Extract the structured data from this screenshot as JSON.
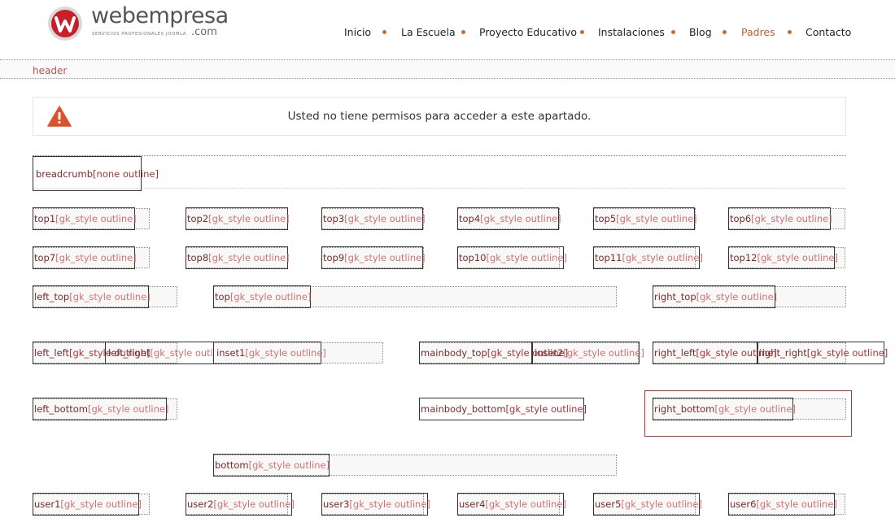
{
  "brand": {
    "name": "webempresa",
    "tagline": "servicios profesionales joomla",
    "suffix": ".com",
    "colors": {
      "red": "#c8202a",
      "accent": "#d0692f",
      "text_red": "#c0504d"
    }
  },
  "nav": {
    "items": [
      {
        "label": "Inicio",
        "active": false
      },
      {
        "label": "La Escuela",
        "active": false
      },
      {
        "label": "Proyecto Educativo",
        "active": false
      },
      {
        "label": "Instalaciones",
        "active": false
      },
      {
        "label": "Blog",
        "active": false
      },
      {
        "label": "Padres",
        "active": true
      },
      {
        "label": "Contacto",
        "active": false
      }
    ]
  },
  "header_label": "header",
  "alert": {
    "icon": "warning-triangle-icon",
    "message": "Usted no tiene permisos para acceder a este apartado."
  },
  "breadcrumb": {
    "position": "breadcrumb",
    "style": "[none outline]"
  },
  "style_label": "[gk_style outline]",
  "rows": {
    "top_a": [
      "top1",
      "top2",
      "top3",
      "top4",
      "top5",
      "top6"
    ],
    "top_b": [
      "top7",
      "top8",
      "top9",
      "top10",
      "top11",
      "top12"
    ],
    "left_top": "left_top",
    "top": "top",
    "right_top": "right_top",
    "left_left": "left_left",
    "left_right": "left_right",
    "inset1": "inset1",
    "mainbody_top": "mainbody_top",
    "inset2": "inset2",
    "right_left": "right_left",
    "right_right": "right_right",
    "left_bottom": "left_bottom",
    "mainbody_bottom": "mainbody_bottom",
    "right_bottom": "right_bottom",
    "bottom": "bottom",
    "user": [
      "user1",
      "user2",
      "user3",
      "user4",
      "user5",
      "user6"
    ]
  }
}
